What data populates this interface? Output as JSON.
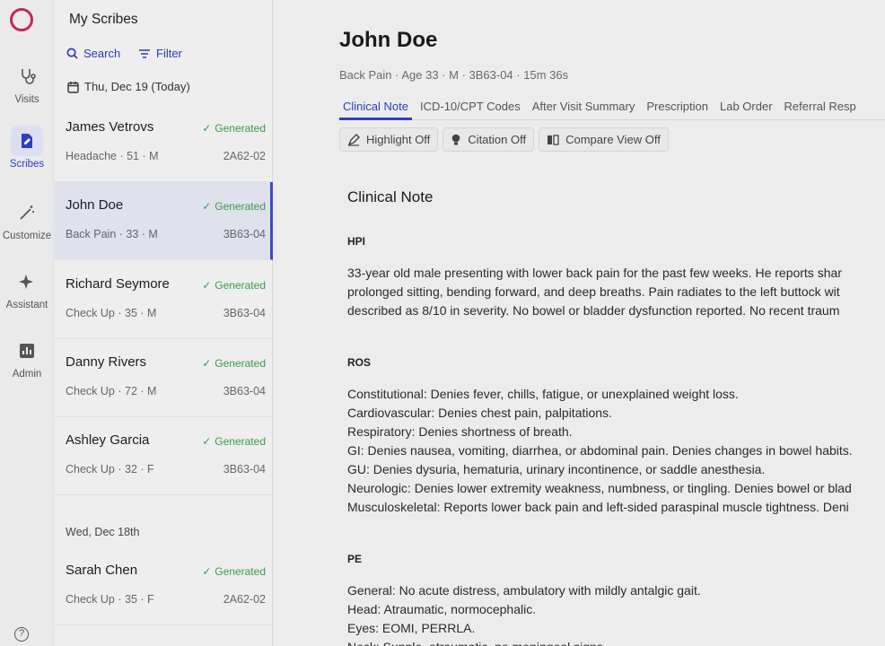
{
  "rail": {
    "items": [
      {
        "label": "Visits",
        "icon": "stethoscope-icon"
      },
      {
        "label": "Scribes",
        "icon": "document-pen-icon"
      },
      {
        "label": "Customize",
        "icon": "magic-wand-icon"
      },
      {
        "label": "Assistant",
        "icon": "sparkle-icon"
      },
      {
        "label": "Admin",
        "icon": "chart-icon"
      }
    ],
    "help_symbol": "?"
  },
  "list": {
    "title": "My Scribes",
    "search_label": "Search",
    "filter_label": "Filter",
    "today_label": "Thu, Dec 19 (Today)",
    "yesterday_label": "Wed, Dec 18th",
    "scribes": [
      {
        "name": "James Vetrovs",
        "status": "Generated",
        "sub": "Headache · 51 · M",
        "code": "2A62-02"
      },
      {
        "name": "John Doe",
        "status": "Generated",
        "sub": "Back Pain · 33 · M",
        "code": "3B63-04"
      },
      {
        "name": "Richard Seymore",
        "status": "Generated",
        "sub": "Check Up · 35 · M",
        "code": "3B63-04"
      },
      {
        "name": "Danny Rivers",
        "status": "Generated",
        "sub": "Check Up · 72 · M",
        "code": "3B63-04"
      },
      {
        "name": "Ashley Garcia",
        "status": "Generated",
        "sub": "Check Up · 32 · F",
        "code": "3B63-04"
      },
      {
        "name": "Sarah Chen",
        "status": "Generated",
        "sub": "Check Up · 35 · F",
        "code": "2A62-02"
      }
    ]
  },
  "main": {
    "patient_name": "John Doe",
    "meta": "Back Pain · Age 33 · M · 3B63-04 · 15m 36s",
    "tabs": [
      "Clinical Note",
      "ICD-10/CPT Codes",
      "After Visit Summary",
      "Prescription",
      "Lab Order",
      "Referral Resp"
    ],
    "toggles": [
      "Highlight Off",
      "Citation Off",
      "Compare View Off"
    ],
    "note_title": "Clinical Note",
    "hpi_heading": "HPI",
    "hpi_lines": [
      "33-year old male presenting with lower back pain for the past few weeks. He reports shar",
      "prolonged sitting, bending forward, and deep breaths. Pain radiates to the left buttock wit",
      "described as 8/10 in severity. No bowel or bladder dysfunction reported. No recent traum"
    ],
    "ros_heading": "ROS",
    "ros_lines": [
      "Constitutional: Denies fever, chills, fatigue, or unexplained weight loss.",
      "Cardiovascular: Denies chest pain, palpitations.",
      "Respiratory: Denies shortness of breath.",
      "GI: Denies nausea, vomiting, diarrhea, or abdominal pain. Denies changes in bowel habits.",
      "GU: Denies dysuria, hematuria, urinary incontinence, or saddle anesthesia.",
      "Neurologic: Denies lower extremity weakness, numbness, or tingling. Denies bowel or blad",
      "Musculoskeletal: Reports lower back pain and left-sided paraspinal muscle tightness. Deni"
    ],
    "pe_heading": "PE",
    "pe_lines": [
      "General: No acute distress, ambulatory with mildly antalgic gait.",
      "Head: Atraumatic, normocephalic.",
      "Eyes: EOMI, PERRLA.",
      "Neck: Supple, atraumatic, no meningeal signs."
    ]
  },
  "colors": {
    "brand": "#c8245f",
    "accent": "#2d3ec4",
    "status_green": "#3a9b4a"
  }
}
